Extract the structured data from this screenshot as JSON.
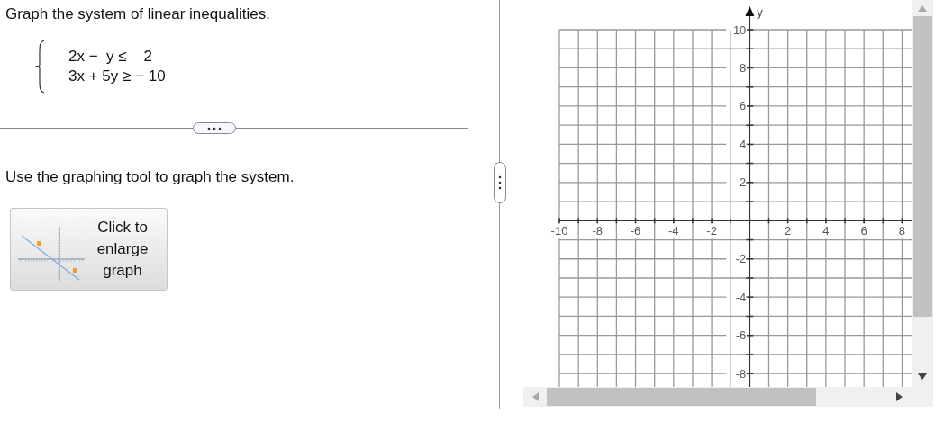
{
  "prompt": "Graph the system of linear inequalities.",
  "system": [
    "2x −  y ≤    2",
    "3x + 5y ≥ − 10"
  ],
  "instruction": "Use the graphing tool to graph the system.",
  "enlarge_button": "Click to enlarge graph",
  "graph": {
    "chart_data": {
      "type": "scatter",
      "grid": true,
      "ylabel": "y",
      "xlim": [
        -10,
        8.5
      ],
      "ylim": [
        -8.7,
        10
      ],
      "xticks": [
        -10,
        -8,
        -6,
        -4,
        -2,
        2,
        4,
        6,
        8
      ],
      "yticks": [
        -8,
        -6,
        -4,
        -2,
        2,
        4,
        6,
        8,
        10
      ]
    }
  }
}
